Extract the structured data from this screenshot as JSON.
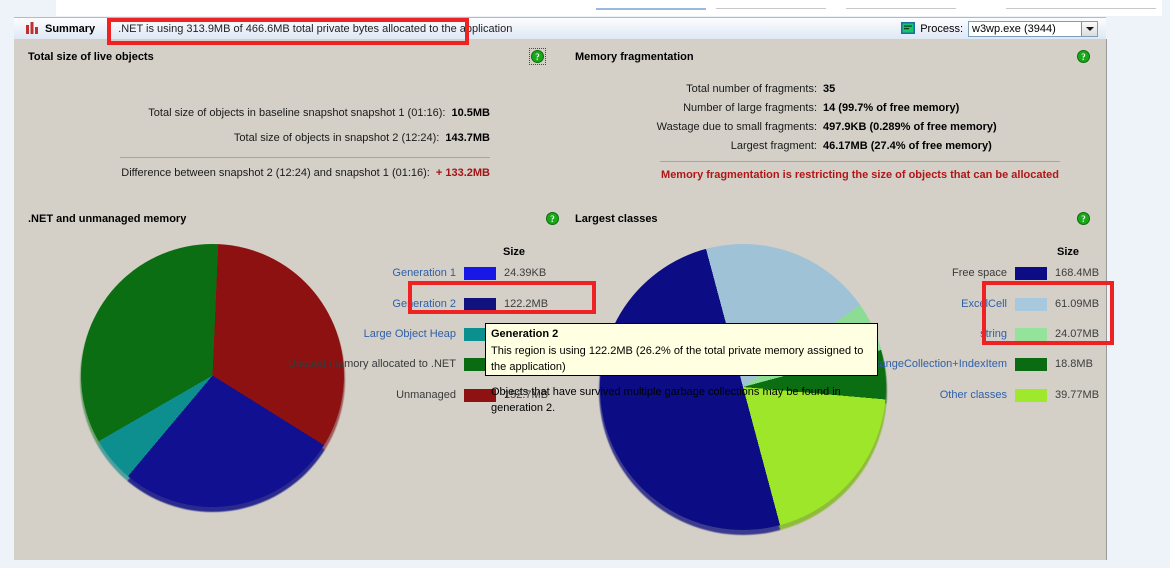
{
  "window": {
    "summary_tab_label": "Summary",
    "summary_text": ".NET is using 313.9MB of 466.6MB total private bytes allocated to the application",
    "process_label": "Process:",
    "process_value": "w3wp.exe (3944)"
  },
  "panels": {
    "live_objects": {
      "title": "Total size of live objects",
      "rows": [
        {
          "label": "Total size of objects in baseline snapshot snapshot 1 (01:16):",
          "value": "10.5MB"
        },
        {
          "label": "Total size of objects in snapshot 2 (12:24):",
          "value": "143.7MB"
        }
      ],
      "diff_label": "Difference between snapshot 2 (12:24) and snapshot 1 (01:16):",
      "diff_value": "+ 133.2MB"
    },
    "fragmentation": {
      "title": "Memory fragmentation",
      "rows": [
        {
          "label": "Total number of fragments:",
          "value": "35"
        },
        {
          "label": "Number of large fragments:",
          "value": "14 (99.7% of free memory)"
        },
        {
          "label": "Wastage due to small fragments:",
          "value": "497.9KB (0.289% of free memory)"
        },
        {
          "label": "Largest fragment:",
          "value": "46.17MB (27.4% of free memory)"
        }
      ],
      "warning": "Memory fragmentation is restricting the size of objects that can be allocated"
    },
    "dotnet_memory": {
      "title": ".NET and unmanaged memory"
    },
    "largest_classes": {
      "title": "Largest classes"
    }
  },
  "tooltip": {
    "title": "Generation 2",
    "line2": "This region is using 122.2MB (26.2% of the total private memory assigned to the application)",
    "line3": "Objects that have survived multiple garbage collections may be found in generation 2."
  },
  "chart_data": [
    {
      "type": "pie",
      "title": ".NET and unmanaged memory",
      "size_header": "Size",
      "unit": "MB",
      "categories": [
        "Generation 1",
        "Generation 2",
        "Large Object Heap",
        "Unused memory allocated to .NET",
        "Unmanaged"
      ],
      "labels": [
        "24.39KB",
        "122.2MB",
        "22.10MB",
        "92.19MB",
        "152.7MB"
      ],
      "values": [
        0.0244,
        122.2,
        22.1,
        92.19,
        152.7
      ],
      "colors": [
        "#1717e8",
        "#12127e",
        "#0b8f8f",
        "#0a6b12",
        "#8f1212"
      ],
      "pie_colors": [
        "#1717e8",
        "#101090",
        "#0e8f8f",
        "#0c6e12",
        "#8e1111"
      ],
      "legend_position": "right"
    },
    {
      "type": "pie",
      "title": "Largest classes",
      "size_header": "Size",
      "unit": "MB",
      "categories": [
        "Free space",
        "ExcelCell",
        "string",
        "RangeCollection+IndexItem",
        "Other classes"
      ],
      "labels": [
        "168.4MB",
        "61.09MB",
        "24.07MB",
        "18.8MB",
        "39.77MB"
      ],
      "values": [
        168.4,
        61.09,
        24.07,
        18.8,
        39.77
      ],
      "colors": [
        "#0c0c84",
        "#a8c8dd",
        "#93e39a",
        "#0a6b12",
        "#9ee92b"
      ],
      "pie_colors": [
        "#0c0c84",
        "#9fc2d6",
        "#8ddc96",
        "#0c6e12",
        "#9ee62a"
      ],
      "legend_position": "right"
    }
  ],
  "accents": {
    "annotation_red": "#ee2222",
    "panel_bg": "#d4d0c8",
    "warn_red": "#b01616",
    "diff_red": "#a31515",
    "link_blue": "#2f5fa8"
  }
}
